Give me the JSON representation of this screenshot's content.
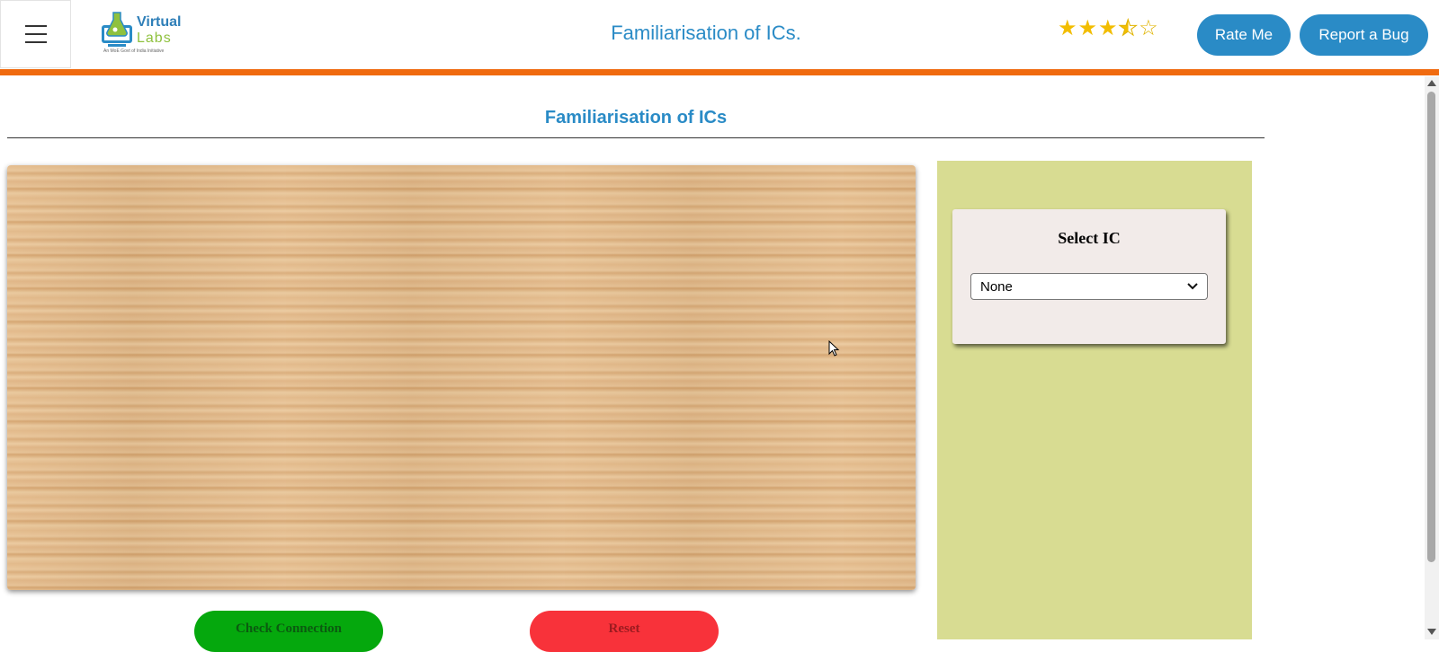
{
  "header": {
    "logo": {
      "title": "Virtual",
      "subtitle": "Labs",
      "tagline": "An MoE Govt of India Initiative"
    },
    "title": "Familiarisation of ICs.",
    "rating": {
      "value": 3.5,
      "max": 5,
      "color": "#f2bd00"
    },
    "rate_label": "Rate Me",
    "bug_label": "Report a Bug",
    "accent_color": "#f06a0f",
    "brand_color": "#2a8bc6"
  },
  "main": {
    "heading": "Familiarisation of ICs",
    "board": {
      "texture": "wood"
    },
    "check_label": "Check Connection",
    "reset_label": "Reset"
  },
  "side": {
    "select_title": "Select IC",
    "select_value": "None",
    "panel_color": "#d8dc92"
  }
}
